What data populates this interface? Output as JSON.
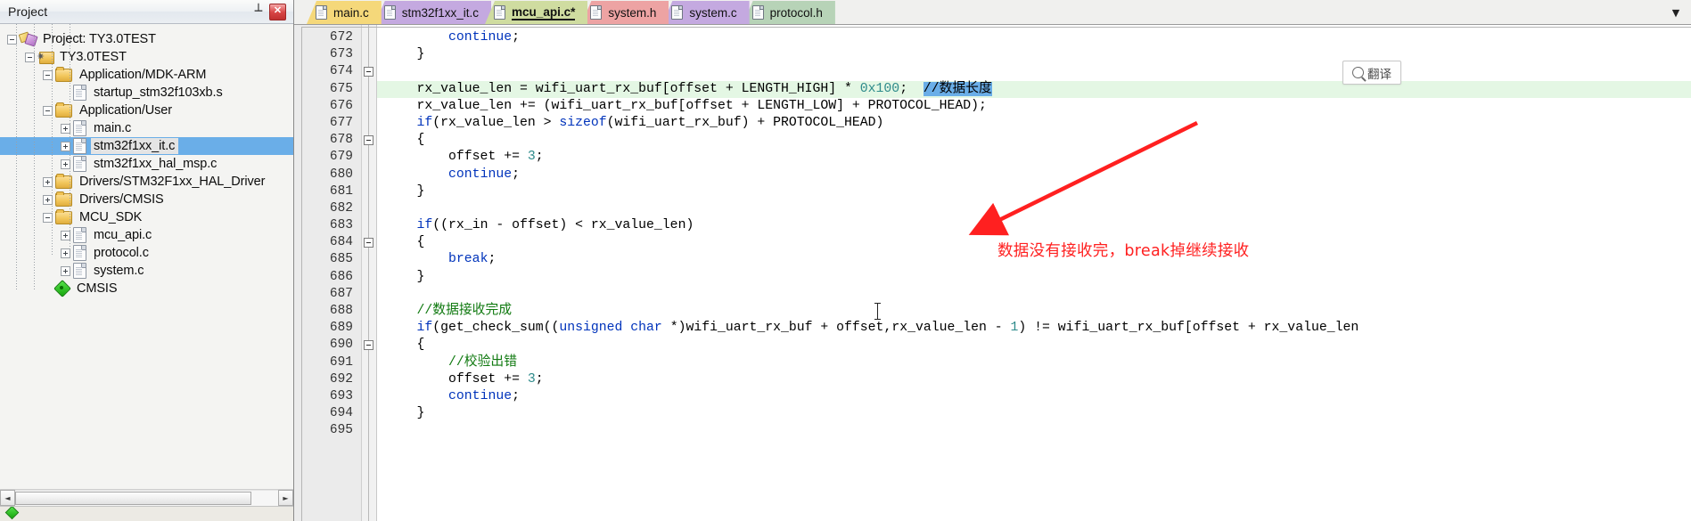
{
  "project_pane": {
    "title": "Project",
    "pin_icon": "pin-icon",
    "close_icon": "close-icon",
    "tree": [
      {
        "label": "Project: TY3.0TEST",
        "indent": 0,
        "icon": "project-icon",
        "expander": "minus"
      },
      {
        "label": "TY3.0TEST",
        "indent": 1,
        "icon": "target-icon",
        "expander": "minus"
      },
      {
        "label": "Application/MDK-ARM",
        "indent": 2,
        "icon": "folder-icon",
        "expander": "minus"
      },
      {
        "label": "startup_stm32f103xb.s",
        "indent": 3,
        "icon": "file-icon",
        "expander": "none"
      },
      {
        "label": "Application/User",
        "indent": 2,
        "icon": "folder-icon",
        "expander": "minus"
      },
      {
        "label": "main.c",
        "indent": 3,
        "icon": "file-icon",
        "expander": "plus"
      },
      {
        "label": "stm32f1xx_it.c",
        "indent": 3,
        "icon": "file-icon",
        "expander": "plus",
        "selected": true
      },
      {
        "label": "stm32f1xx_hal_msp.c",
        "indent": 3,
        "icon": "file-icon",
        "expander": "plus"
      },
      {
        "label": "Drivers/STM32F1xx_HAL_Driver",
        "indent": 2,
        "icon": "folder-icon",
        "expander": "plus"
      },
      {
        "label": "Drivers/CMSIS",
        "indent": 2,
        "icon": "folder-icon",
        "expander": "plus"
      },
      {
        "label": "MCU_SDK",
        "indent": 2,
        "icon": "folder-icon",
        "expander": "minus"
      },
      {
        "label": "mcu_api.c",
        "indent": 3,
        "icon": "file-icon",
        "expander": "plus"
      },
      {
        "label": "protocol.c",
        "indent": 3,
        "icon": "file-icon",
        "expander": "plus"
      },
      {
        "label": "system.c",
        "indent": 3,
        "icon": "file-icon",
        "expander": "plus"
      },
      {
        "label": "CMSIS",
        "indent": 2,
        "icon": "cmsis-icon",
        "expander": "none"
      }
    ],
    "scroll_left_arrow": "◄",
    "scroll_right_arrow": "►",
    "bottom_tab_label": ""
  },
  "editor": {
    "tabs": [
      {
        "label": "main.c",
        "color": "#f5d87a",
        "active": false,
        "modified": false
      },
      {
        "label": "stm32f1xx_it.c",
        "color": "#c4a9e0",
        "active": false,
        "modified": false
      },
      {
        "label": "mcu_api.c*",
        "color": "#cfdca0",
        "active": true,
        "modified": true
      },
      {
        "label": "system.h",
        "color": "#eda3a3",
        "active": false,
        "modified": false
      },
      {
        "label": "system.c",
        "color": "#c4a9e0",
        "active": false,
        "modified": false
      },
      {
        "label": "protocol.h",
        "color": "#b7d3b7",
        "active": false,
        "modified": false
      }
    ],
    "tabbar_overflow_icon": "chevron-down-icon",
    "first_line_number": 672,
    "lines": [
      {
        "n": 672,
        "tokens": [
          {
            "t": "        ",
            "c": "plain"
          },
          {
            "t": "continue",
            "c": "kw"
          },
          {
            "t": ";",
            "c": "plain"
          }
        ]
      },
      {
        "n": 673,
        "tokens": [
          {
            "t": "    }",
            "c": "plain"
          }
        ]
      },
      {
        "n": 674,
        "tokens": [
          {
            "t": "",
            "c": "plain"
          }
        ],
        "fold": true
      },
      {
        "n": 675,
        "highlight": true,
        "tokens": [
          {
            "t": "    rx_value_len = wifi_uart_rx_buf[offset + LENGTH_HIGH] * ",
            "c": "plain"
          },
          {
            "t": "0x100",
            "c": "num"
          },
          {
            "t": ";  ",
            "c": "plain"
          },
          {
            "t": "//数据长度",
            "c": "selected"
          }
        ]
      },
      {
        "n": 676,
        "tokens": [
          {
            "t": "    rx_value_len += (wifi_uart_rx_buf[offset + LENGTH_LOW] + PROTOCOL_HEAD);",
            "c": "plain"
          }
        ]
      },
      {
        "n": 677,
        "tokens": [
          {
            "t": "    ",
            "c": "plain"
          },
          {
            "t": "if",
            "c": "kw"
          },
          {
            "t": "(rx_value_len > ",
            "c": "plain"
          },
          {
            "t": "sizeof",
            "c": "kw"
          },
          {
            "t": "(wifi_uart_rx_buf) + PROTOCOL_HEAD)",
            "c": "plain"
          }
        ]
      },
      {
        "n": 678,
        "tokens": [
          {
            "t": "    {",
            "c": "plain"
          }
        ],
        "fold": true
      },
      {
        "n": 679,
        "tokens": [
          {
            "t": "        offset += ",
            "c": "plain"
          },
          {
            "t": "3",
            "c": "num"
          },
          {
            "t": ";",
            "c": "plain"
          }
        ]
      },
      {
        "n": 680,
        "tokens": [
          {
            "t": "        ",
            "c": "plain"
          },
          {
            "t": "continue",
            "c": "kw"
          },
          {
            "t": ";",
            "c": "plain"
          }
        ]
      },
      {
        "n": 681,
        "tokens": [
          {
            "t": "    }",
            "c": "plain"
          }
        ]
      },
      {
        "n": 682,
        "tokens": [
          {
            "t": "",
            "c": "plain"
          }
        ]
      },
      {
        "n": 683,
        "tokens": [
          {
            "t": "    ",
            "c": "plain"
          },
          {
            "t": "if",
            "c": "kw"
          },
          {
            "t": "((rx_in - offset) < rx_value_len)",
            "c": "plain"
          }
        ]
      },
      {
        "n": 684,
        "tokens": [
          {
            "t": "    {",
            "c": "plain"
          }
        ],
        "fold": true
      },
      {
        "n": 685,
        "tokens": [
          {
            "t": "        ",
            "c": "plain"
          },
          {
            "t": "break",
            "c": "kw"
          },
          {
            "t": ";",
            "c": "plain"
          }
        ]
      },
      {
        "n": 686,
        "tokens": [
          {
            "t": "    }",
            "c": "plain"
          }
        ]
      },
      {
        "n": 687,
        "tokens": [
          {
            "t": "",
            "c": "plain"
          }
        ]
      },
      {
        "n": 688,
        "tokens": [
          {
            "t": "    ",
            "c": "plain"
          },
          {
            "t": "//数据接收完成",
            "c": "cmt"
          }
        ]
      },
      {
        "n": 689,
        "tokens": [
          {
            "t": "    ",
            "c": "plain"
          },
          {
            "t": "if",
            "c": "kw"
          },
          {
            "t": "(get_check_sum((",
            "c": "plain"
          },
          {
            "t": "unsigned char",
            "c": "kw"
          },
          {
            "t": " *)wifi_uart_rx_buf + offset,rx_value_len - ",
            "c": "plain"
          },
          {
            "t": "1",
            "c": "num"
          },
          {
            "t": ") != wifi_uart_rx_buf[offset + rx_value_len",
            "c": "plain"
          }
        ]
      },
      {
        "n": 690,
        "tokens": [
          {
            "t": "    {",
            "c": "plain"
          }
        ],
        "fold": true
      },
      {
        "n": 691,
        "tokens": [
          {
            "t": "        ",
            "c": "plain"
          },
          {
            "t": "//校验出错",
            "c": "cmt"
          }
        ]
      },
      {
        "n": 692,
        "tokens": [
          {
            "t": "        offset += ",
            "c": "plain"
          },
          {
            "t": "3",
            "c": "num"
          },
          {
            "t": ";",
            "c": "plain"
          }
        ]
      },
      {
        "n": 693,
        "tokens": [
          {
            "t": "        ",
            "c": "plain"
          },
          {
            "t": "continue",
            "c": "kw"
          },
          {
            "t": ";",
            "c": "plain"
          }
        ]
      },
      {
        "n": 694,
        "tokens": [
          {
            "t": "    }",
            "c": "plain"
          }
        ]
      },
      {
        "n": 695,
        "tokens": [
          {
            "t": "",
            "c": "plain"
          }
        ]
      }
    ],
    "translate_button": {
      "label": "翻译",
      "icon": "search-icon"
    },
    "annotation": {
      "text": "数据没有接收完，break掉继续接收",
      "color": "#ff2020",
      "arrow": "red-arrow"
    }
  },
  "colors": {
    "keyword": "#0033bb",
    "number": "#2e8b8b",
    "comment": "#117a11",
    "selection": "#6aaee8",
    "line_highlight": "#e4f7e4",
    "annotation_red": "#ff2020"
  }
}
